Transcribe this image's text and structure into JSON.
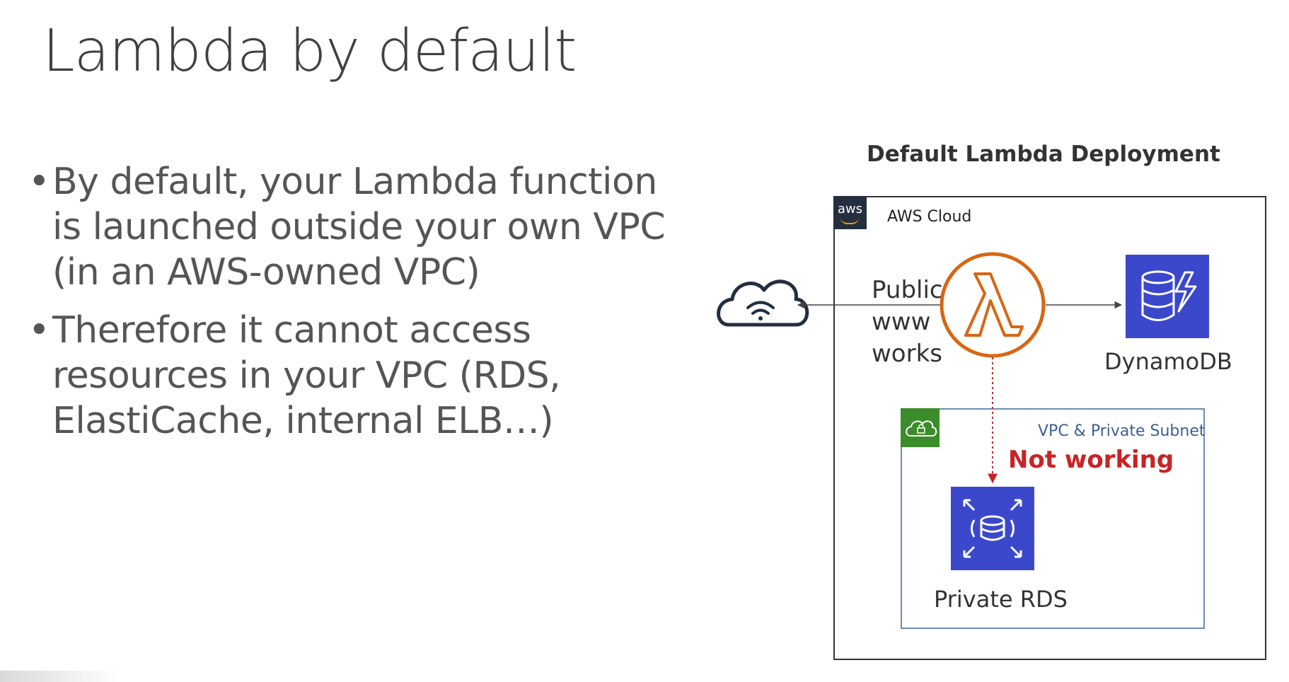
{
  "slide": {
    "title": "Lambda by default",
    "bullets": [
      "By default, your Lambda function is launched outside your own VPC (in an AWS-owned VPC)",
      "Therefore it cannot access resources in your VPC (RDS, ElastiCache, internal ELB…)"
    ]
  },
  "diagram": {
    "title": "Default Lambda Deployment",
    "aws_logo_text": "aws",
    "aws_cloud_label": "AWS Cloud",
    "public_label": [
      "Public",
      "www",
      "works"
    ],
    "dynamodb_label": "DynamoDB",
    "vpc_label": "VPC & Private Subnet",
    "not_working_label": "Not working",
    "rds_label": "Private RDS",
    "icons": [
      "internet-cloud-icon",
      "lambda-icon",
      "dynamodb-icon",
      "rds-icon",
      "vpc-lock-cloud-icon",
      "aws-logo-icon"
    ],
    "colors": {
      "lambda_orange": "#d86613",
      "dynamodb_blue": "#3b48cc",
      "rds_blue": "#3b48cc",
      "vpc_green": "#3b8c2a",
      "not_working_red": "#c82326",
      "vpc_border": "#6a8db5"
    }
  }
}
